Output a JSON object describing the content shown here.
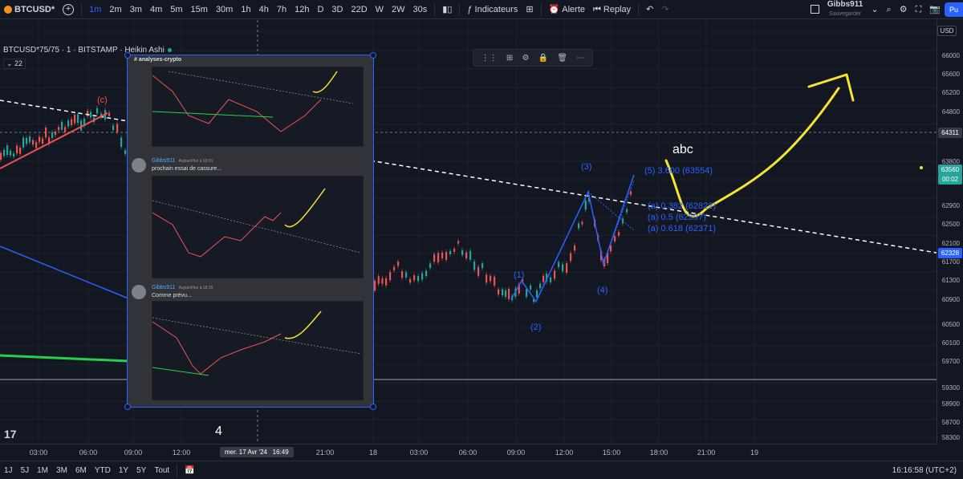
{
  "toolbar": {
    "symbol": "BTCUSD*",
    "intervals": [
      "1m",
      "2m",
      "3m",
      "4m",
      "5m",
      "15m",
      "30m",
      "1h",
      "4h",
      "7h",
      "12h",
      "D",
      "3D",
      "22D",
      "W",
      "2W",
      "30s"
    ],
    "active_interval": "1m",
    "indicators_label": "Indicateurs",
    "alert_label": "Alerte",
    "replay_label": "Replay",
    "user_name": "Gibbs911",
    "user_status": "Sauvegarder",
    "publish_label": "Pu"
  },
  "legend": {
    "title": "BTCUSD*75/75 · 1 · BITSTAMP · Heikin Ashi",
    "sub": "22"
  },
  "price_axis": {
    "currency": "USD",
    "ticks": [
      "66000",
      "65600",
      "65200",
      "64800",
      "64400",
      "63800",
      "63300",
      "62900",
      "62500",
      "62100",
      "61700",
      "61300",
      "60900",
      "60500",
      "60100",
      "59700",
      "59300",
      "58900",
      "58700",
      "58300"
    ],
    "crosshair_price": "64311",
    "current_price": "63560",
    "countdown": "00:02",
    "marker_price": "62328"
  },
  "time_axis": {
    "ticks": [
      "03:00",
      "06:00",
      "09:00",
      "12:00",
      "18",
      "03:00",
      "06:00",
      "09:00",
      "12:00",
      "15:00",
      "18:00",
      "21:00",
      "19"
    ],
    "cursor_label": "mer. 17 Avr '24",
    "cursor_time": "16:49",
    "extra_tick": "21:00"
  },
  "bottom_bar": {
    "ranges": [
      "1J",
      "5J",
      "1M",
      "3M",
      "6M",
      "YTD",
      "1Y",
      "5Y",
      "Tout"
    ],
    "clock": "16:16:58 (UTC+2)"
  },
  "annotations": {
    "c_label": "(c)",
    "w1": "(1)",
    "w2": "(2)",
    "w3": "(3)",
    "w4": "(4)",
    "w5": "(5) 3.600 (63554)",
    "fib1": "(a) 0.382 (62822)",
    "fib2": "(a) 0.5 (62597)",
    "fib3": "(a) 0.618 (62371)",
    "abc": "abc",
    "cursor_number": "4"
  },
  "overlay": {
    "channel": "analyses-crypto",
    "messages": [
      {
        "author": "Gibbs911",
        "time": "Aujourd'hui à 10:01",
        "text": "prochain essai de cassure..."
      },
      {
        "author": "Gibbs911",
        "time": "Aujourd'hui à 16:15",
        "text": "Comme prévu..."
      }
    ]
  },
  "colors": {
    "background": "#131722",
    "accent": "#2962ff",
    "up": "#26a69a",
    "down": "#ef5350",
    "drawing_yellow": "#f5e335"
  }
}
